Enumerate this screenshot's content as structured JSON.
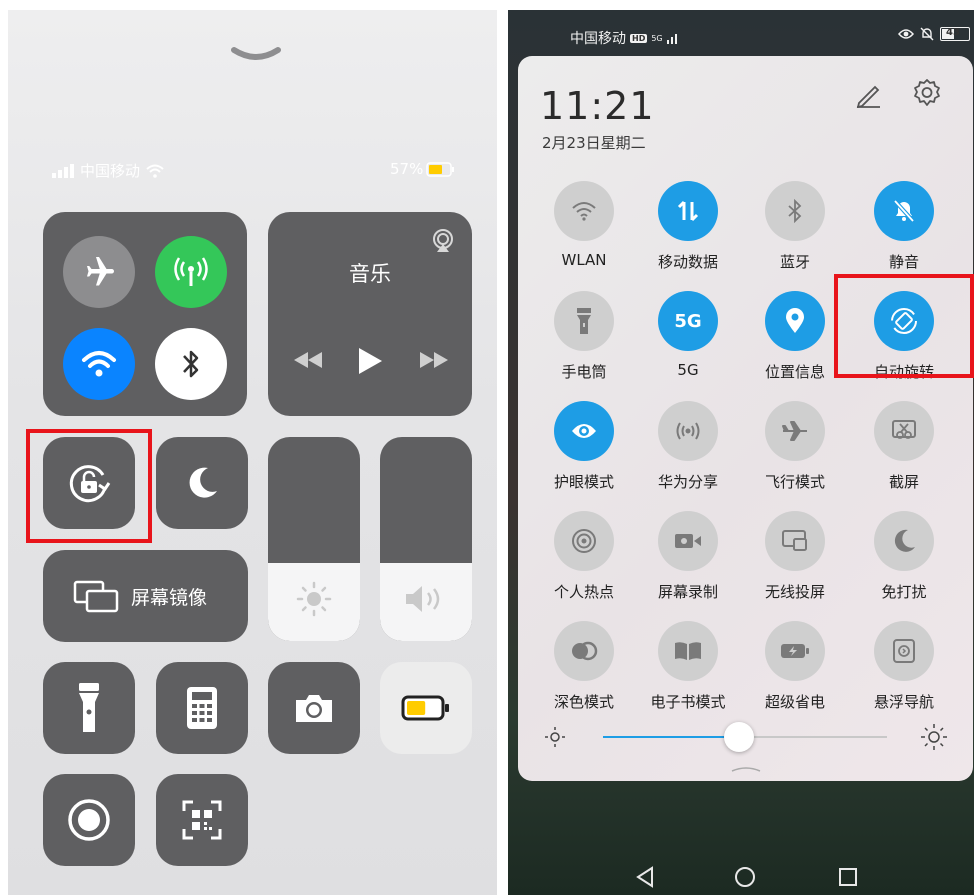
{
  "left": {
    "status": {
      "carrier": "中国移动",
      "battery_percent": "57%"
    },
    "music": {
      "title": "音乐"
    },
    "screen_mirroring": {
      "label": "屏幕镜像"
    },
    "brightness_level": 0.38,
    "volume_level": 0.38,
    "battery_level": 0.57
  },
  "right": {
    "status": {
      "carrier": "中国移动",
      "hd": "HD",
      "net": "5G",
      "battery": "43"
    },
    "time": "11:21",
    "date": "2月23日星期二",
    "toggles": [
      {
        "label": "WLAN",
        "icon": "wifi-icon",
        "on": false
      },
      {
        "label": "移动数据",
        "icon": "mobile-data-icon",
        "on": true
      },
      {
        "label": "蓝牙",
        "icon": "bluetooth-icon",
        "on": false
      },
      {
        "label": "静音",
        "icon": "bell-off-icon",
        "on": true
      },
      {
        "label": "手电筒",
        "icon": "flashlight-icon",
        "on": false
      },
      {
        "label": "5G",
        "icon": "5g-icon",
        "on": true,
        "text": "5G"
      },
      {
        "label": "位置信息",
        "icon": "location-icon",
        "on": true
      },
      {
        "label": "自动旋转",
        "icon": "auto-rotate-icon",
        "on": true
      },
      {
        "label": "护眼模式",
        "icon": "eye-icon",
        "on": true
      },
      {
        "label": "华为分享",
        "icon": "huawei-share-icon",
        "on": false
      },
      {
        "label": "飞行模式",
        "icon": "airplane-icon",
        "on": false
      },
      {
        "label": "截屏",
        "icon": "screenshot-icon",
        "on": false
      },
      {
        "label": "个人热点",
        "icon": "hotspot-icon",
        "on": false
      },
      {
        "label": "屏幕录制",
        "icon": "screen-record-icon",
        "on": false
      },
      {
        "label": "无线投屏",
        "icon": "wireless-projection-icon",
        "on": false
      },
      {
        "label": "免打扰",
        "icon": "moon-icon",
        "on": false
      },
      {
        "label": "深色模式",
        "icon": "dark-mode-icon",
        "on": false
      },
      {
        "label": "电子书模式",
        "icon": "ebook-icon",
        "on": false
      },
      {
        "label": "超级省电",
        "icon": "battery-saver-icon",
        "on": false
      },
      {
        "label": "悬浮导航",
        "icon": "floating-nav-icon",
        "on": false
      }
    ],
    "brightness_level": 0.48
  },
  "colors": {
    "accent_blue": "#1e9de5",
    "ios_green": "#34c759",
    "ios_blue": "#0a84ff",
    "highlight_red": "#e8141b"
  }
}
